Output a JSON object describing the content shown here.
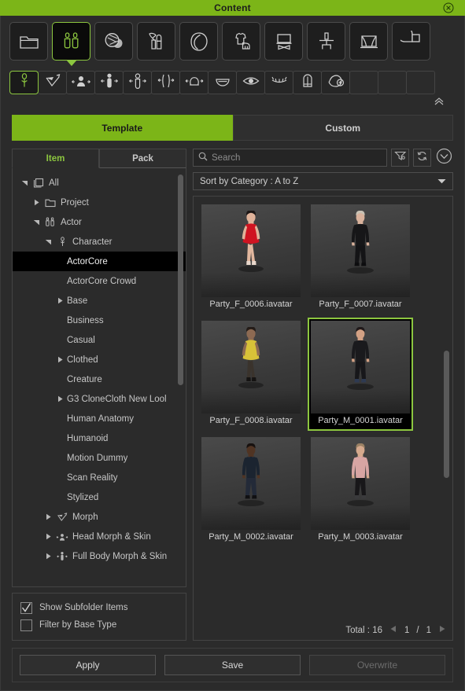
{
  "window": {
    "title": "Content",
    "close_icon": "close-circle-icon"
  },
  "toolbar_primary": [
    {
      "id": "project",
      "icon": "folder-icon",
      "label": "Project",
      "active": false
    },
    {
      "id": "actor",
      "icon": "two-people-icon",
      "label": "Actor",
      "active": true
    },
    {
      "id": "material",
      "icon": "material-spheres-icon",
      "label": "Material",
      "active": false
    },
    {
      "id": "makeup",
      "icon": "brush-lipstick-icon",
      "label": "Makeup",
      "active": false
    },
    {
      "id": "hair",
      "icon": "hair-icon",
      "label": "Hair",
      "active": false
    },
    {
      "id": "cloth",
      "icon": "cloth-shoe-icon",
      "label": "Cloth",
      "active": false
    },
    {
      "id": "prop",
      "icon": "prop-table-icon",
      "label": "Prop",
      "active": false
    },
    {
      "id": "motion",
      "icon": "motion-figure-icon",
      "label": "Motion",
      "active": false
    },
    {
      "id": "stage",
      "icon": "stage-curtain-icon",
      "label": "Stage",
      "active": false
    },
    {
      "id": "media",
      "icon": "pie-layer-icon",
      "label": "Media",
      "active": false
    }
  ],
  "toolbar_secondary": [
    {
      "id": "character",
      "icon": "character-pin-icon",
      "active": true
    },
    {
      "id": "morph",
      "icon": "morph-arrow-icon",
      "active": false
    },
    {
      "id": "head-morph-skin",
      "icon": "head-morph-icon",
      "active": false
    },
    {
      "id": "full-body-morph-skin",
      "icon": "full-body-morph-icon",
      "active": false
    },
    {
      "id": "body-morph",
      "icon": "body-morph-icon",
      "active": false
    },
    {
      "id": "leg-morph",
      "icon": "leg-morph-icon",
      "active": false
    },
    {
      "id": "head-skin",
      "icon": "head-skin-icon",
      "active": false
    },
    {
      "id": "mouth",
      "icon": "mouth-icon",
      "active": false
    },
    {
      "id": "eye",
      "icon": "eye-icon",
      "active": false
    },
    {
      "id": "eyelash",
      "icon": "eyelash-icon",
      "active": false
    },
    {
      "id": "teeth",
      "icon": "teeth-icon",
      "active": false
    },
    {
      "id": "face-add",
      "icon": "face-plus-icon",
      "active": false
    },
    {
      "id": "blank-1",
      "icon": "blank-icon",
      "active": false
    },
    {
      "id": "blank-2",
      "icon": "blank-icon",
      "active": false
    },
    {
      "id": "blank-3",
      "icon": "blank-icon",
      "active": false
    }
  ],
  "collapse_icon": "chevron-double-up-icon",
  "main_tabs": [
    {
      "id": "template",
      "label": "Template",
      "active": true
    },
    {
      "id": "custom",
      "label": "Custom",
      "active": false
    }
  ],
  "left_panel": {
    "tabs": [
      {
        "id": "item",
        "label": "Item",
        "active": true
      },
      {
        "id": "pack",
        "label": "Pack",
        "active": false
      }
    ],
    "tree": [
      {
        "label": "All",
        "depth": 0,
        "twisty": "open",
        "icon": "layers-icon",
        "selected": false
      },
      {
        "label": "Project",
        "depth": 1,
        "twisty": "closed",
        "icon": "folder-icon",
        "selected": false
      },
      {
        "label": "Actor",
        "depth": 1,
        "twisty": "open",
        "icon": "two-people-icon",
        "selected": false
      },
      {
        "label": "Character",
        "depth": 2,
        "twisty": "open",
        "icon": "character-icon",
        "selected": false
      },
      {
        "label": "ActorCore",
        "depth": 3,
        "twisty": "none",
        "icon": "none",
        "selected": true
      },
      {
        "label": "ActorCore Crowd",
        "depth": 3,
        "twisty": "none",
        "icon": "none",
        "selected": false
      },
      {
        "label": "Base",
        "depth": 3,
        "twisty": "closed",
        "icon": "none",
        "selected": false
      },
      {
        "label": "Business",
        "depth": 3,
        "twisty": "none",
        "icon": "none",
        "selected": false
      },
      {
        "label": "Casual",
        "depth": 3,
        "twisty": "none",
        "icon": "none",
        "selected": false
      },
      {
        "label": "Clothed",
        "depth": 3,
        "twisty": "closed",
        "icon": "none",
        "selected": false
      },
      {
        "label": "Creature",
        "depth": 3,
        "twisty": "none",
        "icon": "none",
        "selected": false
      },
      {
        "label": "G3 CloneCloth New Lool",
        "depth": 3,
        "twisty": "closed",
        "icon": "none",
        "selected": false
      },
      {
        "label": "Human Anatomy",
        "depth": 3,
        "twisty": "none",
        "icon": "none",
        "selected": false
      },
      {
        "label": "Humanoid",
        "depth": 3,
        "twisty": "none",
        "icon": "none",
        "selected": false
      },
      {
        "label": "Motion Dummy",
        "depth": 3,
        "twisty": "none",
        "icon": "none",
        "selected": false
      },
      {
        "label": "Scan Reality",
        "depth": 3,
        "twisty": "none",
        "icon": "none",
        "selected": false
      },
      {
        "label": "Stylized",
        "depth": 3,
        "twisty": "none",
        "icon": "none",
        "selected": false
      },
      {
        "label": "Morph",
        "depth": 2,
        "twisty": "closed",
        "icon": "morph-arrow-icon",
        "selected": false
      },
      {
        "label": "Head Morph & Skin",
        "depth": 2,
        "twisty": "closed",
        "icon": "head-morph-icon",
        "selected": false
      },
      {
        "label": "Full Body Morph & Skin",
        "depth": 2,
        "twisty": "closed",
        "icon": "full-body-morph-icon",
        "selected": false
      }
    ],
    "checkboxes": [
      {
        "id": "show-subfolder-items",
        "label": "Show Subfolder Items",
        "checked": true
      },
      {
        "id": "filter-by-base-type",
        "label": "Filter by Base Type",
        "checked": false
      }
    ]
  },
  "right_panel": {
    "search": {
      "value": "",
      "placeholder": "Search",
      "icon": "search-icon"
    },
    "filter_button_icon": "filter-settings-icon",
    "refresh_button_icon": "refresh-circular-icon",
    "expand_button_icon": "chevron-down-circle-icon",
    "sort": {
      "label": "Sort by Category : A to Z",
      "arrow_icon": "triangle-down-icon"
    },
    "items": [
      {
        "name": "Party_F_0006.iavatar",
        "selected": false,
        "variant": "f6"
      },
      {
        "name": "Party_F_0007.iavatar",
        "selected": false,
        "variant": "f7"
      },
      {
        "name": "Party_F_0008.iavatar",
        "selected": false,
        "variant": "f8"
      },
      {
        "name": "Party_M_0001.iavatar",
        "selected": true,
        "variant": "m1"
      },
      {
        "name": "Party_M_0002.iavatar",
        "selected": false,
        "variant": "m2"
      },
      {
        "name": "Party_M_0003.iavatar",
        "selected": false,
        "variant": "m3"
      }
    ],
    "pagination": {
      "total_label": "Total : 16",
      "prev_icon": "triangle-left-icon",
      "current_page": "1",
      "separator": "/",
      "total_pages": "1",
      "next_icon": "triangle-right-icon"
    }
  },
  "footer": {
    "apply_label": "Apply",
    "save_label": "Save",
    "overwrite_label": "Overwrite",
    "overwrite_disabled": true
  },
  "colors": {
    "accent_green": "#7cb518",
    "highlight_green": "#8cc63f",
    "panel_bg": "#2b2b2b",
    "selection_black": "#000000"
  }
}
